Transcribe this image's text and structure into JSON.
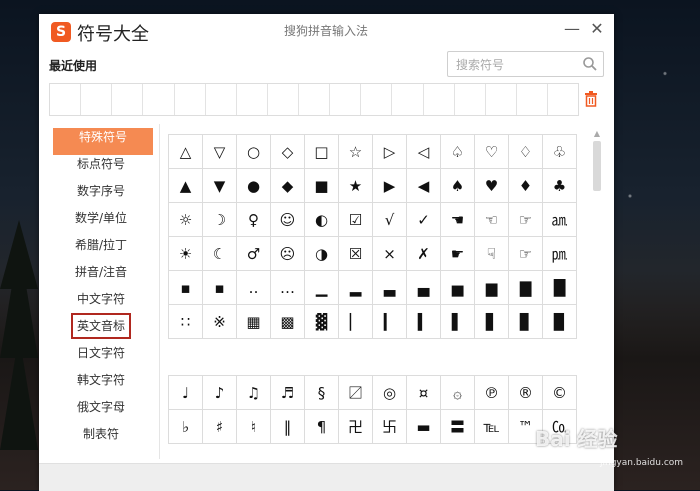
{
  "app": {
    "logo_letter": "S",
    "title": "符号大全",
    "ime_title": "搜狗拼音输入法",
    "minimize": "—",
    "close": "✕"
  },
  "recent": {
    "label": "最近使用",
    "slot_count": 17
  },
  "search": {
    "placeholder": "搜索符号"
  },
  "sidebar": {
    "items": [
      {
        "label": "特殊符号",
        "active": true
      },
      {
        "label": "标点符号"
      },
      {
        "label": "数字序号"
      },
      {
        "label": "数学/单位"
      },
      {
        "label": "希腊/拉丁"
      },
      {
        "label": "拼音/注音"
      },
      {
        "label": "中文字符"
      },
      {
        "label": "英文音标",
        "highlighted": true
      },
      {
        "label": "日文字符"
      },
      {
        "label": "韩文字符"
      },
      {
        "label": "俄文字母"
      },
      {
        "label": "制表符"
      }
    ]
  },
  "symbols_group1": [
    [
      "△",
      "▽",
      "○",
      "◇",
      "□",
      "☆",
      "▷",
      "◁",
      "♤",
      "♡",
      "♢",
      "♧"
    ],
    [
      "▲",
      "▼",
      "●",
      "◆",
      "■",
      "★",
      "▶",
      "◀",
      "♠",
      "♥",
      "♦",
      "♣"
    ],
    [
      "☼",
      "☽",
      "♀",
      "☺",
      "◐",
      "☑",
      "√",
      "✓",
      "☚",
      "☜",
      "☞",
      "㏂"
    ],
    [
      "☀",
      "☾",
      "♂",
      "☹",
      "◑",
      "☒",
      "×",
      "✗",
      "☛",
      "☟",
      "☞",
      "㏘"
    ],
    [
      "▪",
      "▪",
      "‥",
      "…",
      "▁",
      "▂",
      "▃",
      "▄",
      "▅",
      "▆",
      "▇",
      "█"
    ],
    [
      "∷",
      "※",
      "▦",
      "▩",
      "▓",
      "▏",
      "▎",
      "▍",
      "▌",
      "▋",
      "▊",
      "▉"
    ]
  ],
  "symbols_group2": [
    [
      "♩",
      "♪",
      "♫",
      "♬",
      "§",
      "〼",
      "◎",
      "¤",
      "۞",
      "℗",
      "®",
      "©"
    ],
    [
      "♭",
      "♯",
      "♮",
      "‖",
      "¶",
      "卍",
      "卐",
      "▬",
      "〓",
      "℡",
      "™",
      "㏇"
    ]
  ],
  "watermark": {
    "brand": "Bai 经验",
    "url": "jingyan.baidu.com"
  },
  "colors": {
    "accent": "#f58a52",
    "logo": "#f05a22",
    "highlight_box": "#b0281f"
  }
}
